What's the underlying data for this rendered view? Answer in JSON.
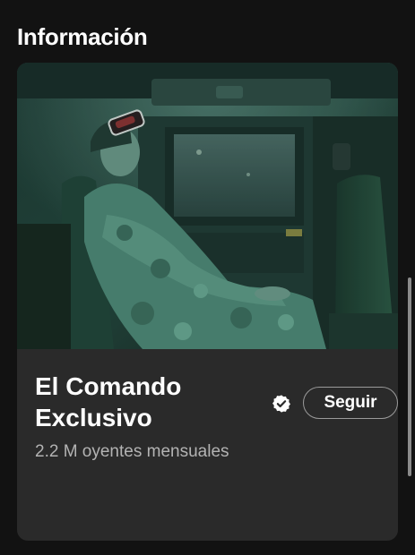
{
  "section": {
    "title": "Información"
  },
  "artist": {
    "name": "El Comando Exclusivo",
    "verified_icon": "verified-badge-icon",
    "follow_label": "Seguir",
    "monthly_listeners": "2.2 M oyentes mensuales"
  },
  "colors": {
    "background": "#121212",
    "card": "#2a2a2a",
    "text_secondary": "#b3b3b3",
    "photo_tint": "#2f6e5a"
  }
}
